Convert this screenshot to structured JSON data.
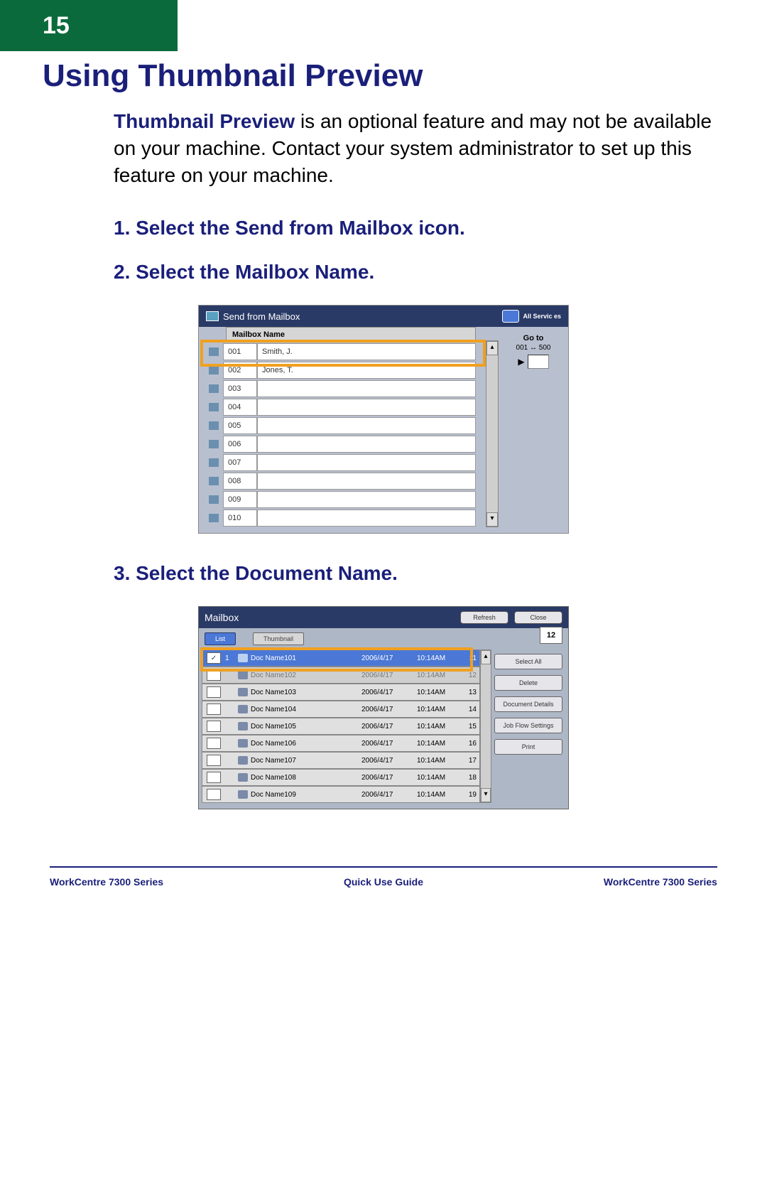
{
  "page_number": "15",
  "title": "Using Thumbnail Preview",
  "intro_lead": "Thumbnail Preview",
  "intro_rest": " is an optional feature and may not be available on your machine. Contact your system administrator to set up this feature on your machine.",
  "steps": {
    "s1": "1. Select the Send from Mailbox icon.",
    "s2": "2. Select the Mailbox Name.",
    "s3": "3. Select the Document Name."
  },
  "shot1": {
    "title": "Send from Mailbox",
    "all_services": "All Servic es",
    "header": "Mailbox Name",
    "goto_label": "Go to",
    "goto_range": "001 ↔ 500",
    "rows": [
      {
        "num": "001",
        "name": "Smith, J."
      },
      {
        "num": "002",
        "name": "Jones, T."
      },
      {
        "num": "003",
        "name": ""
      },
      {
        "num": "004",
        "name": ""
      },
      {
        "num": "005",
        "name": ""
      },
      {
        "num": "006",
        "name": ""
      },
      {
        "num": "007",
        "name": ""
      },
      {
        "num": "008",
        "name": ""
      },
      {
        "num": "009",
        "name": ""
      },
      {
        "num": "010",
        "name": ""
      }
    ]
  },
  "shot2": {
    "title": "Mailbox",
    "refresh": "Refresh",
    "close": "Close",
    "tab_list": "List",
    "tab_thumb": "Thumbnail",
    "count": "12",
    "side": {
      "select_all": "Select All",
      "delete": "Delete",
      "details": "Document Details",
      "jobflow": "Job Flow Settings",
      "print": "Print"
    },
    "docs": [
      {
        "idx": "1",
        "name": "Doc Name101",
        "date": "2006/4/17",
        "time": "10:14AM",
        "num": "11",
        "sel": true
      },
      {
        "idx": "",
        "name": "Doc Name102",
        "date": "2006/4/17",
        "time": "10:14AM",
        "num": "12",
        "dim": true
      },
      {
        "idx": "",
        "name": "Doc Name103",
        "date": "2006/4/17",
        "time": "10:14AM",
        "num": "13"
      },
      {
        "idx": "",
        "name": "Doc Name104",
        "date": "2006/4/17",
        "time": "10:14AM",
        "num": "14"
      },
      {
        "idx": "",
        "name": "Doc Name105",
        "date": "2006/4/17",
        "time": "10:14AM",
        "num": "15"
      },
      {
        "idx": "",
        "name": "Doc Name106",
        "date": "2006/4/17",
        "time": "10:14AM",
        "num": "16"
      },
      {
        "idx": "",
        "name": "Doc Name107",
        "date": "2006/4/17",
        "time": "10:14AM",
        "num": "17"
      },
      {
        "idx": "",
        "name": "Doc Name108",
        "date": "2006/4/17",
        "time": "10:14AM",
        "num": "18"
      },
      {
        "idx": "",
        "name": "Doc Name109",
        "date": "2006/4/17",
        "time": "10:14AM",
        "num": "19"
      }
    ]
  },
  "footer": {
    "left": "WorkCentre 7300 Series",
    "center": "Quick Use Guide",
    "right": "WorkCentre 7300 Series"
  }
}
